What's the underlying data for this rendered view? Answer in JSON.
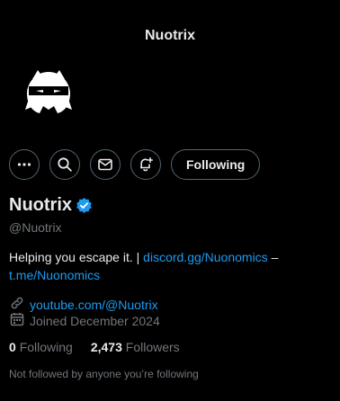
{
  "header": {
    "title": "Nuotrix"
  },
  "profile": {
    "display_name": "Nuotrix",
    "handle": "@Nuotrix",
    "bio": {
      "text_before": "Helping you escape it. | ",
      "link1": "discord.gg/Nuonomics",
      "separator": " –",
      "link2": "t.me/Nuonomics"
    },
    "website": "youtube.com/@Nuotrix",
    "joined": "Joined December 2024"
  },
  "actions": {
    "more_icon": "more-dots-icon",
    "search_icon": "search-icon",
    "message_icon": "envelope-icon",
    "notify_icon": "bell-plus-icon",
    "follow_label": "Following"
  },
  "stats": {
    "following_count": "0",
    "following_label": "Following",
    "followers_count": "2,473",
    "followers_label": "Followers"
  },
  "note": "Not followed by anyone you’re following",
  "colors": {
    "background": "#000000",
    "text": "#e7e9ea",
    "muted": "#71767b",
    "link": "#1d9bf0",
    "border": "#536471",
    "verified": "#1d9bf0"
  }
}
